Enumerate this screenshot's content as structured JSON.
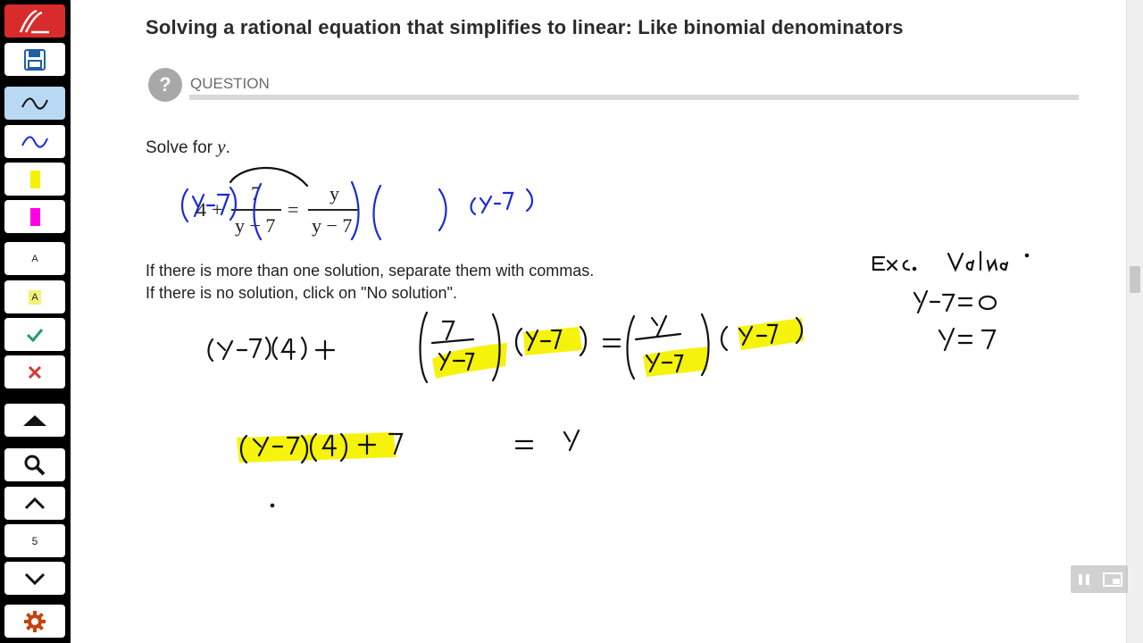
{
  "title": "Solving a rational equation that simplifies to linear: Like binomial denominators",
  "question": {
    "icon": "question-circle-icon",
    "label": "QUESTION"
  },
  "problem": {
    "prompt": "Solve for",
    "variable": "y",
    "equation": {
      "const": "4",
      "plus": "+",
      "num_left": "7",
      "den_left": "y − 7",
      "equals": "=",
      "num_right": "y",
      "den_right": "y − 7"
    },
    "instruction_line1": "If there is more than one solution, separate them with commas.",
    "instruction_line2": "If there is no solution, click on \"No solution\"."
  },
  "toolbar": {
    "buttons": [
      {
        "name": "app-logo-icon",
        "interactable": true
      },
      {
        "name": "save-icon",
        "interactable": true
      },
      {
        "name": "pen-black-icon",
        "interactable": true,
        "active": true
      },
      {
        "name": "pen-blue-icon",
        "interactable": true
      },
      {
        "name": "highlighter-yellow-icon",
        "interactable": true
      },
      {
        "name": "highlighter-magenta-icon",
        "interactable": true
      },
      {
        "name": "text-tool-icon",
        "interactable": true
      },
      {
        "name": "text-highlight-icon",
        "interactable": true
      },
      {
        "name": "check-icon",
        "interactable": true
      },
      {
        "name": "delete-icon",
        "interactable": true
      },
      {
        "name": "eraser-icon",
        "interactable": true
      },
      {
        "name": "search-icon",
        "interactable": true
      },
      {
        "name": "page-up-icon",
        "interactable": true
      },
      {
        "name": "page-down-icon",
        "interactable": true
      },
      {
        "name": "settings-gear-icon",
        "interactable": true
      }
    ],
    "text_tool_label": "A",
    "text_highlight_label": "A",
    "page_number": "5"
  },
  "colors": {
    "pen_blue": "#1a2ad8",
    "highlight_yellow": "#f5f200",
    "highlight_magenta": "#ff00e6",
    "check_green": "#1f9e6a",
    "delete_red": "#d2372f",
    "logo_red": "#d92b2b"
  }
}
